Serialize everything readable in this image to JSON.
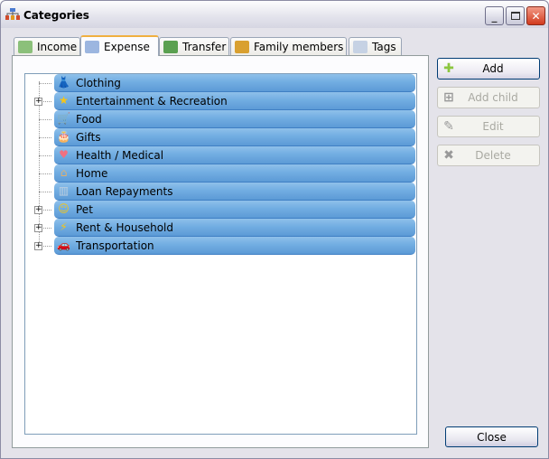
{
  "window": {
    "title": "Categories",
    "icon": "categories-icon"
  },
  "tabs": [
    {
      "label": "Income",
      "icon": "income-icon"
    },
    {
      "label": "Expense",
      "icon": "expense-icon",
      "active": true
    },
    {
      "label": "Transfer",
      "icon": "transfer-icon"
    },
    {
      "label": "Family members",
      "icon": "family-icon"
    },
    {
      "label": "Tags",
      "icon": "tag-icon"
    }
  ],
  "categories": [
    {
      "label": "Clothing",
      "icon": "clothing-icon",
      "expandable": false
    },
    {
      "label": "Entertainment & Recreation",
      "icon": "star-icon",
      "expandable": true
    },
    {
      "label": "Food",
      "icon": "cart-icon",
      "expandable": false
    },
    {
      "label": "Gifts",
      "icon": "cake-icon",
      "expandable": false
    },
    {
      "label": "Health / Medical",
      "icon": "heart-icon",
      "expandable": false
    },
    {
      "label": "Home",
      "icon": "house-icon",
      "expandable": false
    },
    {
      "label": "Loan Repayments",
      "icon": "building-icon",
      "expandable": false
    },
    {
      "label": "Pet",
      "icon": "smiley-icon",
      "expandable": true
    },
    {
      "label": "Rent & Household",
      "icon": "lightning-icon",
      "expandable": true
    },
    {
      "label": "Transportation",
      "icon": "car-icon",
      "expandable": true
    }
  ],
  "buttons": {
    "add": "Add",
    "add_child": "Add child",
    "edit": "Edit",
    "delete": "Delete",
    "close": "Close"
  },
  "expander": "+"
}
